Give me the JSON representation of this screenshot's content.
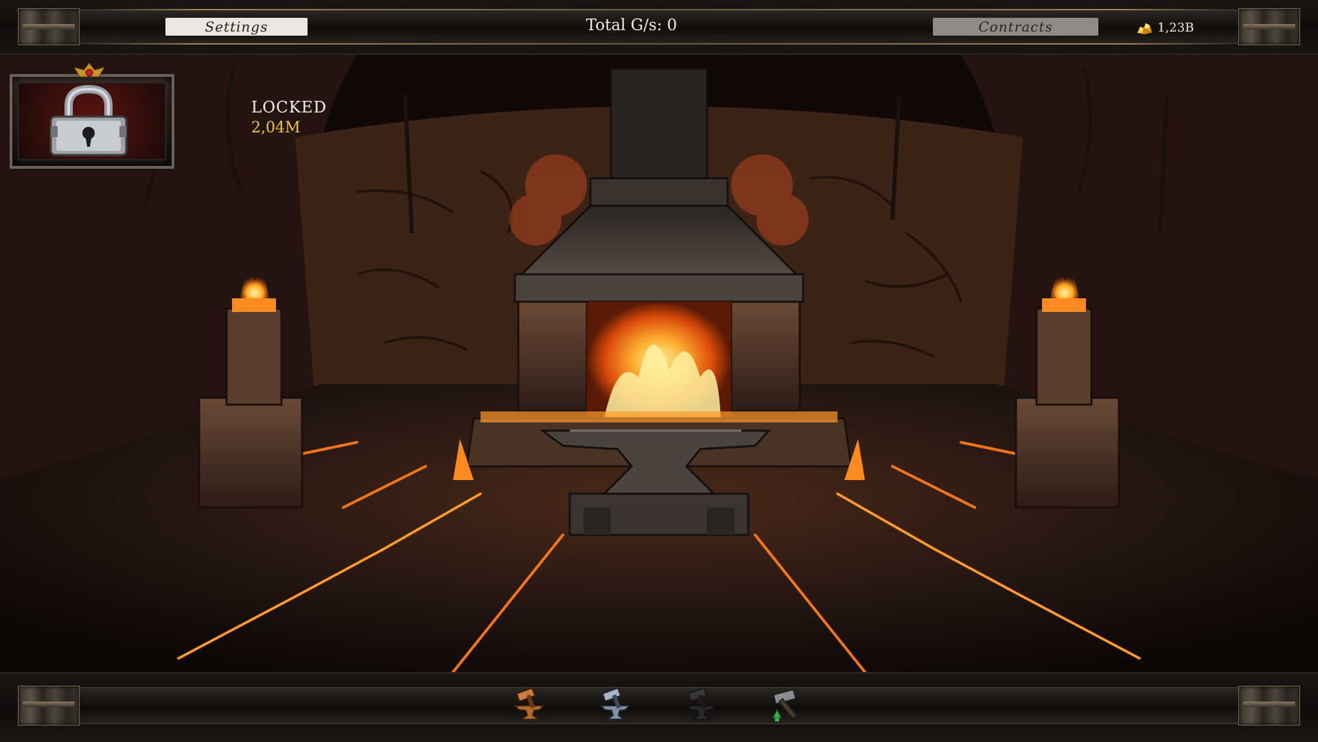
{
  "topbar": {
    "settings_label": "Settings",
    "total_gs": "Total G/s: 0",
    "contracts_label": "Contracts",
    "gold_amount": "1,23B",
    "gold_icon": "gold-nugget-icon"
  },
  "unlock": {
    "status": "LOCKED",
    "cost": "2,04M",
    "icon": "padlock-icon"
  },
  "toolbar": {
    "tools": [
      {
        "name": "bronze-anvil-hammer",
        "icon": "bronze-anvil-icon",
        "color": "#b36a2e"
      },
      {
        "name": "steel-anvil-hammer",
        "icon": "steel-anvil-icon",
        "color": "#7e8fa6"
      },
      {
        "name": "dark-anvil-hammer",
        "icon": "dark-anvil-icon",
        "color": "#3a3a3c"
      },
      {
        "name": "upgrade-hammer",
        "icon": "hammer-upgrade-icon",
        "color": "#3fb34a"
      }
    ]
  },
  "colors": {
    "lava": "#ff7a1a",
    "cost_gold": "#f5c742",
    "settings_bg": "#ece6e2",
    "contracts_bg": "#8f8a87"
  }
}
